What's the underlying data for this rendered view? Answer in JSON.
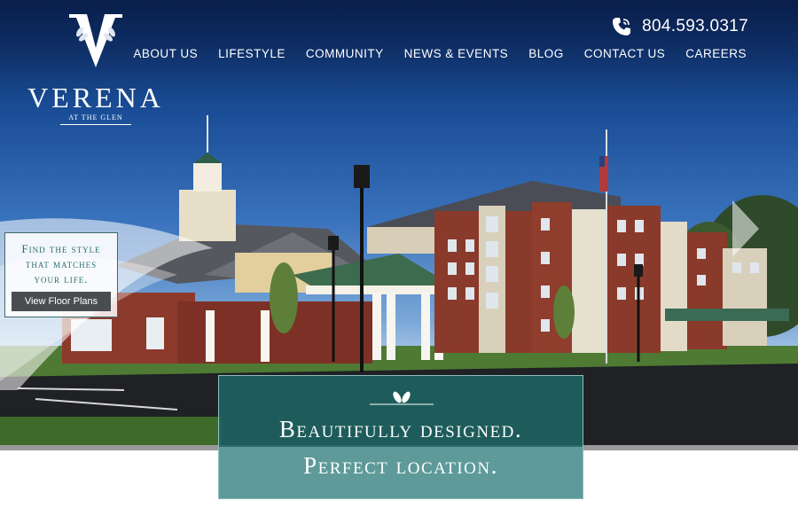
{
  "brand": {
    "initial": "V",
    "name": "VERENA",
    "subtitle": "AT THE GLEN"
  },
  "header": {
    "phone": "804.593.0317"
  },
  "nav": {
    "items": [
      "ABOUT US",
      "LIFESTYLE",
      "COMMUNITY",
      "NEWS & EVENTS",
      "BLOG",
      "CONTACT US",
      "CAREERS"
    ]
  },
  "promo": {
    "title_line1": "Find the style",
    "title_line2": "that matches",
    "title_line3": "your life.",
    "button_label": "View Floor Plans"
  },
  "tagline": {
    "line1": "Beautifully designed.",
    "line2": "Perfect location."
  },
  "colors": {
    "teal_dark": "#1e6462",
    "teal_light": "#5e9a9a",
    "promo_text": "#2b6c6e",
    "button_bg": "#4a4d50"
  },
  "icons": [
    "phone-icon",
    "laurel-icon",
    "leaf-icon",
    "chevron-right-icon"
  ]
}
